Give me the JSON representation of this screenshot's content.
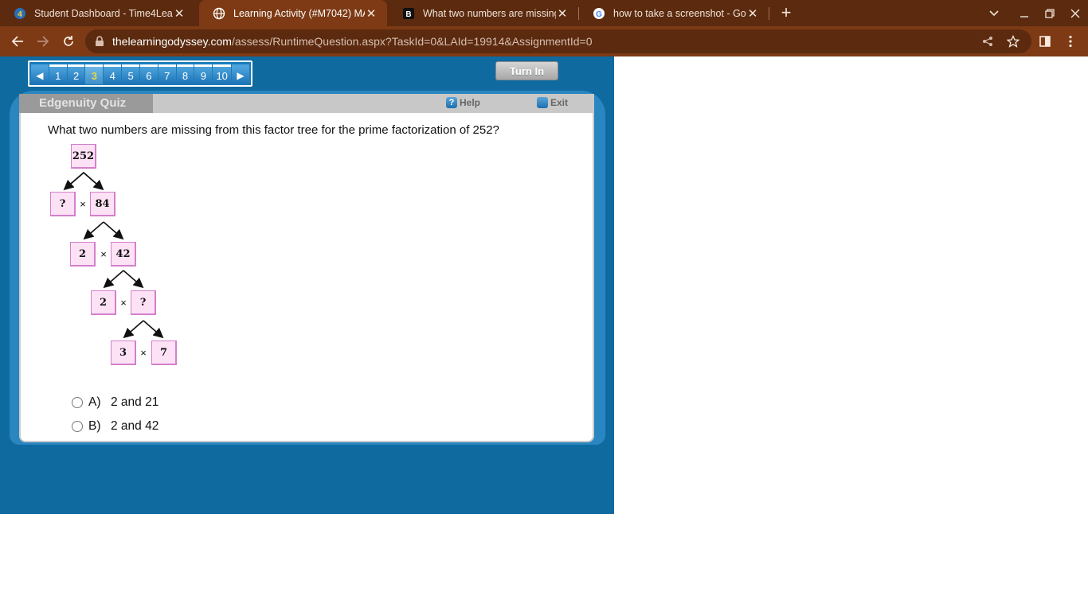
{
  "browser": {
    "tabs": [
      {
        "title": "Student Dashboard - Time4Learning",
        "active": false
      },
      {
        "title": "Learning Activity (#M7042) MA7",
        "active": true
      },
      {
        "title": "What two numbers are missing from",
        "active": false
      },
      {
        "title": "how to take a screenshot - Google",
        "active": false
      }
    ],
    "url_host": "thelearningodyssey.com",
    "url_path": "/assess/RuntimeQuestion.aspx?TaskId=0&LAId=19914&AssignmentId=0",
    "theme_color": "#7d3a14"
  },
  "quiz": {
    "question_numbers": [
      "1",
      "2",
      "3",
      "4",
      "5",
      "6",
      "7",
      "8",
      "9",
      "10"
    ],
    "current_question": "3",
    "turn_in_label": "Turn In",
    "title": "Edgenuity Quiz",
    "help_label": "Help",
    "exit_label": "Exit",
    "question_text": "What two numbers are missing from this factor tree for the prime factorization of 252?",
    "factor_tree": {
      "root": "252",
      "level1": [
        "?",
        "84"
      ],
      "level2": [
        "2",
        "42"
      ],
      "level3": [
        "2",
        "?"
      ],
      "level4": [
        "3",
        "7"
      ],
      "times_symbol": "×"
    },
    "answers": [
      {
        "letter": "A)",
        "text": "2 and 21"
      },
      {
        "letter": "B)",
        "text": "2 and 42"
      }
    ]
  }
}
